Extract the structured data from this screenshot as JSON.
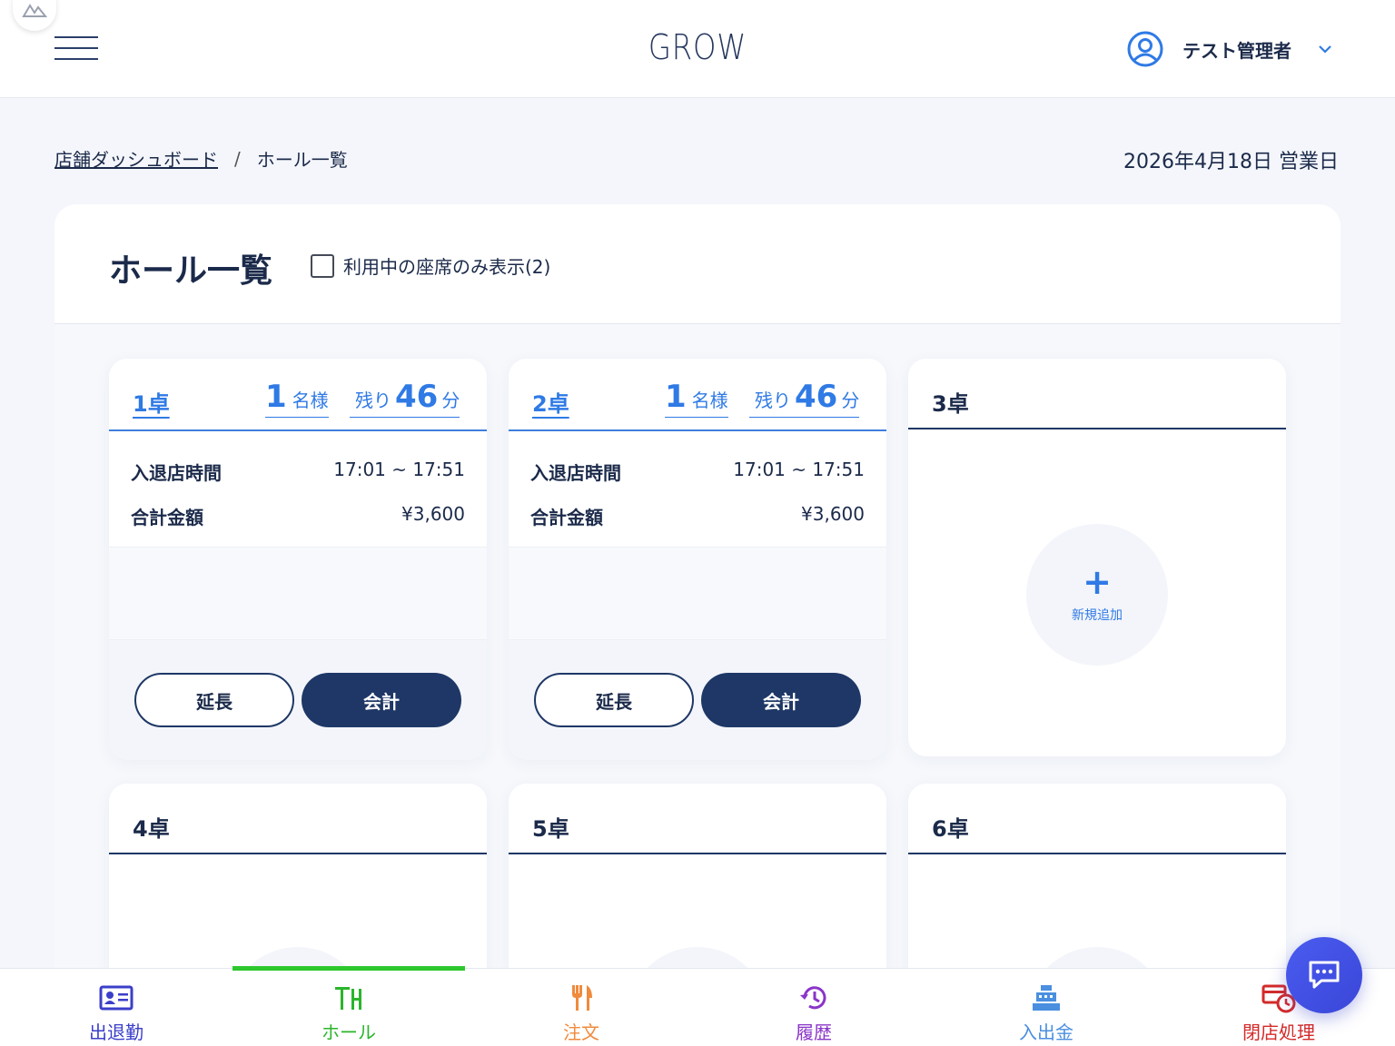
{
  "header": {
    "brand": "GROW",
    "user_name": "テスト管理者"
  },
  "breadcrumb": {
    "parent": "店舗ダッシュボード",
    "separator": "/",
    "current": "ホール一覧"
  },
  "business_date": "2026年4月18日 営業日",
  "panel": {
    "title": "ホール一覧",
    "filter_label": "利用中の座席のみ表示(2)",
    "filter_checked": false
  },
  "tables": [
    {
      "name": "1卓",
      "status": "occupied",
      "guests": "1",
      "guests_unit": "名様",
      "remain_label": "残り",
      "remain": "46",
      "remain_unit": "分",
      "time_label": "入退店時間",
      "time": "17:01 ~ 17:51",
      "total_label": "合計金額",
      "total": "¥3,600",
      "extend_label": "延長",
      "checkout_label": "会計"
    },
    {
      "name": "2卓",
      "status": "occupied",
      "guests": "1",
      "guests_unit": "名様",
      "remain_label": "残り",
      "remain": "46",
      "remain_unit": "分",
      "time_label": "入退店時間",
      "time": "17:01 ~ 17:51",
      "total_label": "合計金額",
      "total": "¥3,600",
      "extend_label": "延長",
      "checkout_label": "会計"
    },
    {
      "name": "3卓",
      "status": "empty",
      "add_label": "新規追加"
    },
    {
      "name": "4卓",
      "status": "empty"
    },
    {
      "name": "5卓",
      "status": "empty"
    },
    {
      "name": "6卓",
      "status": "empty"
    }
  ],
  "bottom_nav": [
    {
      "label": "出退勤",
      "icon": "id-card-icon",
      "color": "#3b3fc9",
      "active": false
    },
    {
      "label": "ホール",
      "icon": "table-icon",
      "color": "#2ab52a",
      "active": true
    },
    {
      "label": "注文",
      "icon": "fork-knife-icon",
      "color": "#f08a3c",
      "active": false
    },
    {
      "label": "履歴",
      "icon": "history-icon",
      "color": "#8a35c9",
      "active": false
    },
    {
      "label": "入出金",
      "icon": "cash-register-icon",
      "color": "#4a8fe0",
      "active": false
    },
    {
      "label": "閉店処理",
      "icon": "store-close-icon",
      "color": "#d42a2a",
      "active": false
    }
  ],
  "colors": {
    "navy": "#1e3766",
    "accent_blue": "#2f7ae5",
    "active_green": "#2ec72e"
  }
}
